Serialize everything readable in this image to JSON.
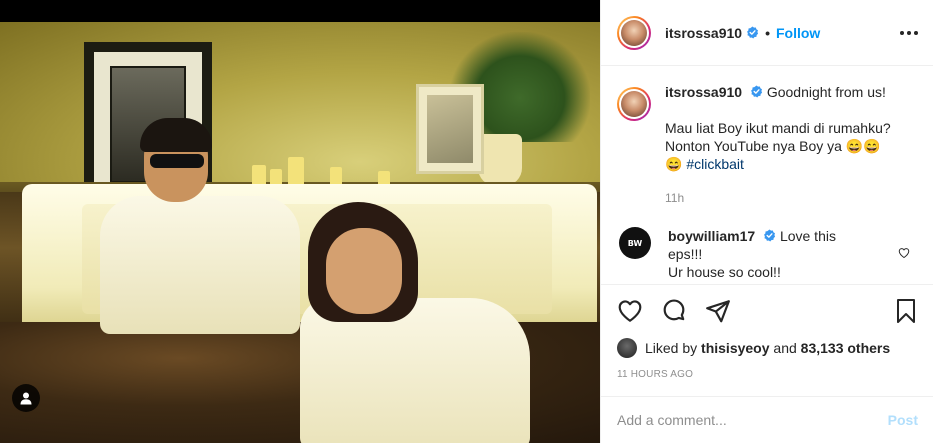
{
  "post": {
    "author": "itsrossa910",
    "follow_label": "Follow",
    "dot": "•",
    "caption": {
      "username": "itsrossa910",
      "line1": "Goodnight from us!",
      "line2": "Mau liat Boy ikut mandi di rumahku?",
      "line3": "Nonton YouTube nya Boy ya 😄😄",
      "line4_emoji": "😄",
      "hashtag": "#clickbait",
      "time": "11h"
    },
    "comments": [
      {
        "username": "boywilliam17",
        "text_line1": "Love this eps!!!",
        "text_line2": "Ur house so cool!!",
        "avatar_text": "BW"
      }
    ],
    "likes": {
      "prefix": "Liked by",
      "user": "thisisyeoy",
      "and": "and",
      "count": "83,133 others"
    },
    "timestamp": "11 HOURS AGO",
    "add_comment": {
      "placeholder": "Add a comment...",
      "post_label": "Post"
    }
  },
  "icons": {
    "verified": "verified-badge-icon",
    "more": "more-options-icon",
    "heart": "heart-icon",
    "comment": "comment-icon",
    "share": "share-icon",
    "save": "bookmark-icon",
    "tag_user": "user-tag-icon"
  },
  "colors": {
    "accent": "#0095f6",
    "verified": "#3897f0",
    "muted": "#8e8e8e",
    "post_disabled": "#b2dffc",
    "hashtag": "#00376b"
  }
}
